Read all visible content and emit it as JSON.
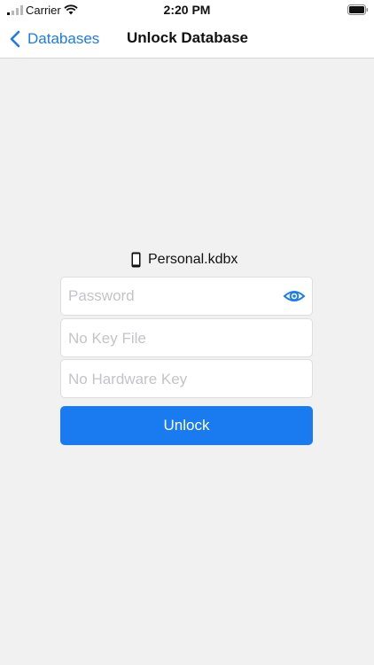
{
  "status_bar": {
    "carrier": "Carrier",
    "time": "2:20 PM",
    "icons": [
      "signal-icon",
      "wifi-icon",
      "battery-icon"
    ]
  },
  "nav": {
    "back_label": "Databases",
    "title": "Unlock Database",
    "icons": [
      "chevron-left-icon"
    ]
  },
  "database": {
    "name": "Personal.kdbx",
    "icon": "phone-icon"
  },
  "form": {
    "password_placeholder": "Password",
    "password_icon": "eye-icon",
    "key_file_text": "No Key File",
    "hardware_key_text": "No Hardware Key",
    "unlock_label": "Unlock"
  },
  "colors": {
    "accent": "#1a7bf0",
    "background": "#f1f1f1",
    "placeholder": "#c4c4c8"
  }
}
